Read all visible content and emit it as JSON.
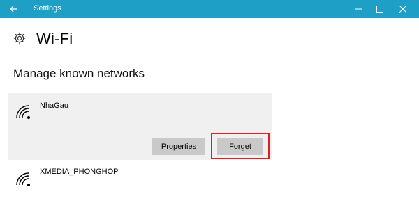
{
  "window": {
    "title": "Settings"
  },
  "page": {
    "title": "Wi-Fi"
  },
  "section": {
    "title": "Manage known networks"
  },
  "networks": [
    {
      "name": "NhaGau",
      "expanded": true,
      "actions": {
        "properties": "Properties",
        "forget": "Forget"
      }
    },
    {
      "name": "XMEDIA_PHONGHOP",
      "expanded": false
    }
  ],
  "colors": {
    "titlebar": "#1e9fc5",
    "card": "#f0f0f0",
    "button": "#c9c9c9",
    "highlight": "#e02020"
  },
  "icons": {
    "back": "back-arrow-icon",
    "settings": "gear-icon",
    "network": "wifi-icon"
  }
}
